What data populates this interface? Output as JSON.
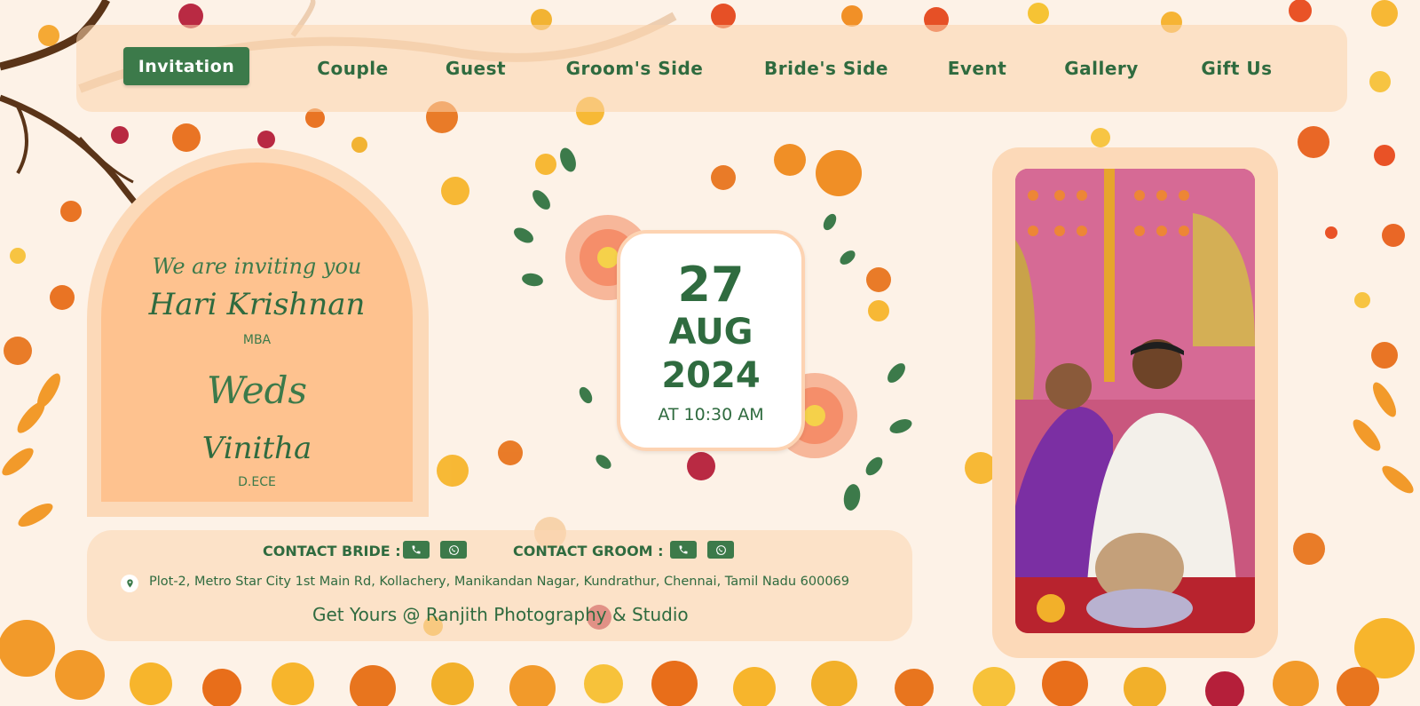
{
  "nav": {
    "items": [
      {
        "label": "Invitation",
        "active": true
      },
      {
        "label": "Couple"
      },
      {
        "label": "Guest"
      },
      {
        "label": "Groom's Side"
      },
      {
        "label": "Bride's Side"
      },
      {
        "label": "Event"
      },
      {
        "label": "Gallery"
      },
      {
        "label": "Gift Us"
      }
    ]
  },
  "invite": {
    "intro": "We are inviting you",
    "groom_name": "Hari Krishnan",
    "groom_degree": "MBA",
    "weds": "Weds",
    "bride_name": "Vinitha",
    "bride_degree": "D.ECE"
  },
  "date": {
    "day": "27",
    "month": "AUG",
    "year": "2024",
    "time": "AT 10:30 AM"
  },
  "contact": {
    "bride_label": "CONTACT BRIDE :",
    "groom_label": "CONTACT GROOM :",
    "address": "Plot-2, Metro Star City 1st Main Rd, Kollachery, Manikandan Nagar, Kundrathur, Chennai, Tamil Nadu 600069",
    "credit": "Get Yours @ Ranjith Photography & Studio"
  },
  "icons": [
    "phone-icon",
    "whatsapp-icon",
    "location-pin-icon"
  ],
  "colors": {
    "primary_green": "#3c7a4a",
    "text_green": "#2f6b3f",
    "peach": "#fec28f",
    "background": "#fdf2e7"
  }
}
